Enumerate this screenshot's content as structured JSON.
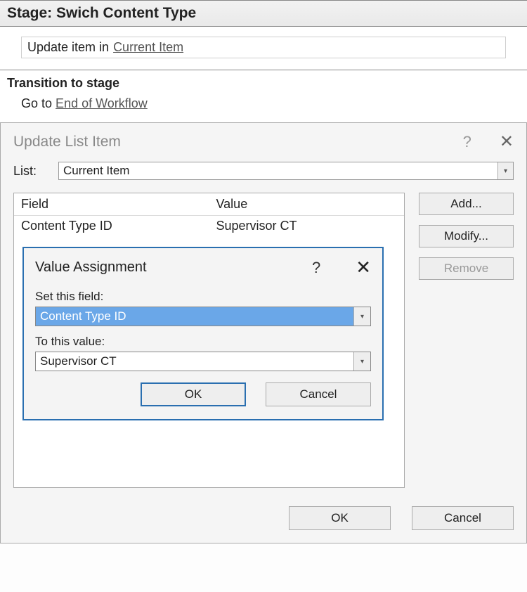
{
  "stage": {
    "prefix": "Stage:",
    "name": "Swich Content Type",
    "action_prefix": "Update item in",
    "action_link": "Current Item"
  },
  "transition": {
    "heading": "Transition to stage",
    "prefix": "Go to",
    "link": "End of Workflow"
  },
  "update_dialog": {
    "title": "Update List Item",
    "list_label": "List:",
    "list_value": "Current Item",
    "columns": {
      "field": "Field",
      "value": "Value"
    },
    "rows": [
      {
        "field": "Content Type ID",
        "value": "Supervisor CT"
      }
    ],
    "buttons": {
      "add": "Add...",
      "modify": "Modify...",
      "remove": "Remove",
      "ok": "OK",
      "cancel": "Cancel"
    }
  },
  "value_dialog": {
    "title": "Value Assignment",
    "set_field_label": "Set this field:",
    "set_field_value": "Content Type ID",
    "to_value_label": "To this value:",
    "to_value_value": "Supervisor CT",
    "ok": "OK",
    "cancel": "Cancel"
  }
}
